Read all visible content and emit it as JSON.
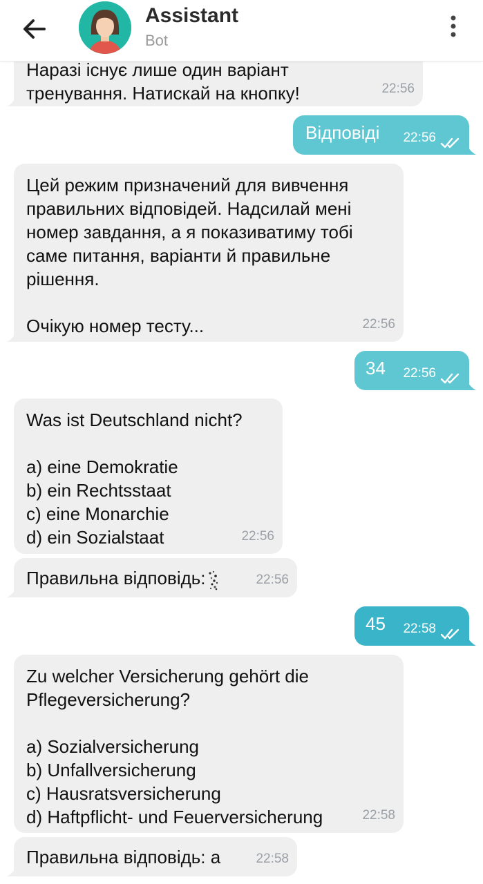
{
  "header": {
    "title": "Assistant",
    "subtitle": "Bot"
  },
  "messages": [
    {
      "id": "m1",
      "dir": "in",
      "text": "Наразі існує лише один варіант\nтренування. Натискай на кнопку!",
      "time": "22:56"
    },
    {
      "id": "m2",
      "dir": "out",
      "text": "Відповіді",
      "time": "22:56"
    },
    {
      "id": "m3",
      "dir": "in",
      "text": "Цей режим призначений для вивчення\nправильних відповідей. Надсилай мені\nномер завдання, а я показиватиму тобі\nсаме питання, варіанти й правильне\nрішення.\n\nОчікую номер тесту...",
      "time": "22:56"
    },
    {
      "id": "m4",
      "dir": "out",
      "text": "34",
      "time": "22:56"
    },
    {
      "id": "m5",
      "dir": "in",
      "text": "Was ist Deutschland nicht?\n\na) eine Demokratie\nb) ein Rechtsstaat\nc) eine Monarchie\nd) ein Sozialstaat",
      "time": "22:56"
    },
    {
      "id": "m6",
      "dir": "in",
      "text": "Правильна відповідь:",
      "time": "22:56"
    },
    {
      "id": "m7",
      "dir": "out",
      "text": "45",
      "time": "22:58"
    },
    {
      "id": "m8",
      "dir": "in",
      "text": "Zu welcher Versicherung gehört die\nPflegeversicherung?\n\na) Sozialversicherung\nb) Unfallversicherung\nc) Hausratsversicherung\nd) Haftpflicht- und Feuerversicherung",
      "time": "22:58"
    },
    {
      "id": "m9",
      "dir": "in",
      "text": "Правильна відповідь: a",
      "time": "22:58"
    }
  ],
  "colors": {
    "incoming_bubble": "#efefef",
    "outgoing_bubble": "#5ec7d2",
    "avatar_bg": "#21b7a4"
  },
  "icons": {
    "back": "arrow-left-icon",
    "menu": "more-vertical-icon",
    "read": "double-check-icon"
  }
}
